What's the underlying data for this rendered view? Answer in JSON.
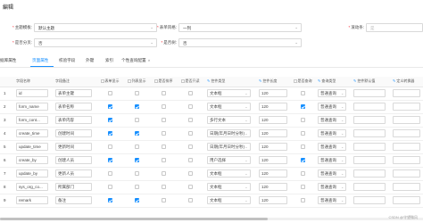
{
  "page": {
    "title": "編辑"
  },
  "form": {
    "main_template": {
      "label": "主题模板:",
      "value": "默认主题"
    },
    "table_style": {
      "label": "表单风格:",
      "value": "一列"
    },
    "scroll_bar": {
      "label": "滚动条:",
      "placeholder": "是"
    },
    "is_branch": {
      "label": "是否分页:",
      "value": "否"
    },
    "is_tree": {
      "label": "是否树:",
      "value": "否"
    }
  },
  "tabs": [
    {
      "label": "据库属性"
    },
    {
      "label": "页面属性"
    },
    {
      "label": "校验字段"
    },
    {
      "label": "外键"
    },
    {
      "label": "索引"
    },
    {
      "label": "个性查询配置"
    }
  ],
  "toolbar": {
    "add_label": "+ 新增"
  },
  "table": {
    "headers": [
      "字段名称",
      "字段备注",
      "表单显示",
      "列表显示",
      "是否排序",
      "是否只读",
      "控件类型",
      "控件长度",
      "是否查询",
      "查询类型",
      "控件默认值",
      "定义转换器"
    ],
    "rows": [
      {
        "num": "1",
        "name": "id",
        "remark": "表单主键",
        "form_show": false,
        "list_show": false,
        "sort": false,
        "readonly": false,
        "control": "文本框",
        "length": "120",
        "query": false,
        "query_type": "普通查询"
      },
      {
        "num": "2",
        "name": "form_name",
        "remark": "表单名称",
        "form_show": true,
        "list_show": true,
        "sort": false,
        "readonly": false,
        "control": "文本框",
        "length": "120",
        "query": true,
        "query_type": "普通查询"
      },
      {
        "num": "3",
        "name": "form_cont...",
        "remark": "表单内容",
        "form_show": true,
        "list_show": false,
        "sort": false,
        "readonly": false,
        "control": "多行文本",
        "length": "120",
        "query": false,
        "query_type": "普通查询"
      },
      {
        "num": "4",
        "name": "create_time",
        "remark": "创建时间",
        "form_show": true,
        "list_show": true,
        "sort": false,
        "readonly": false,
        "control": "日期(年月日时分秒)",
        "length": "120",
        "query": false,
        "query_type": "普通查询"
      },
      {
        "num": "5",
        "name": "update_time",
        "remark": "更新时间",
        "form_show": false,
        "list_show": false,
        "sort": false,
        "readonly": false,
        "control": "日期(年月日时分秒)",
        "length": "120",
        "query": false,
        "query_type": "普通查询"
      },
      {
        "num": "6",
        "name": "create_by",
        "remark": "创建人员",
        "form_show": true,
        "list_show": true,
        "sort": false,
        "readonly": false,
        "control": "用户选择",
        "length": "120",
        "query": true,
        "query_type": "普通查询"
      },
      {
        "num": "7",
        "name": "update_by",
        "remark": "更新人员",
        "form_show": false,
        "list_show": false,
        "sort": false,
        "readonly": false,
        "control": "文本框",
        "length": "120",
        "query": false,
        "query_type": "普通查询"
      },
      {
        "num": "8",
        "name": "sys_org_co...",
        "remark": "所属部门",
        "form_show": false,
        "list_show": false,
        "sort": false,
        "readonly": false,
        "control": "文本框",
        "length": "120",
        "query": false,
        "query_type": "普通查询"
      },
      {
        "num": "9",
        "name": "remark",
        "remark": "备注",
        "form_show": true,
        "list_show": true,
        "sort": false,
        "readonly": false,
        "control": "文本框",
        "length": "120",
        "query": false,
        "query_type": "普通查询"
      }
    ]
  },
  "watermark": "CSDN @守望微风",
  "colors": {
    "accent": "#1890ff",
    "border": "#d9d9d9"
  }
}
